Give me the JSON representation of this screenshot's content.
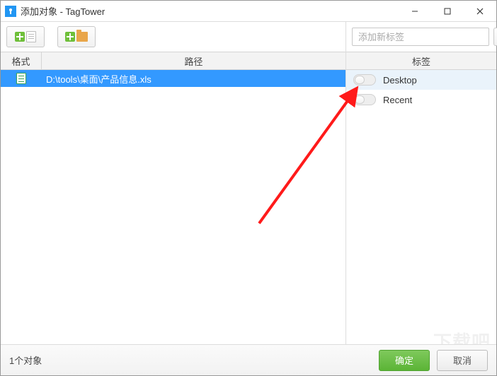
{
  "window": {
    "title": "添加对象 - TagTower"
  },
  "toolbar": {
    "addFileTooltip": "add-file",
    "addFolderTooltip": "add-folder"
  },
  "search": {
    "placeholder": "添加新标签"
  },
  "columns": {
    "format": "格式",
    "path": "路径",
    "tags": "标签"
  },
  "files": [
    {
      "path": "D:\\tools\\桌面\\产品信息.xls",
      "icon": "xls"
    }
  ],
  "tags": [
    {
      "label": "Desktop",
      "checked": false,
      "highlight": true
    },
    {
      "label": "Recent",
      "checked": false,
      "highlight": false
    }
  ],
  "status": {
    "count_text": "1个对象"
  },
  "buttons": {
    "ok": "确定",
    "cancel": "取消"
  },
  "watermark": "下载吧"
}
